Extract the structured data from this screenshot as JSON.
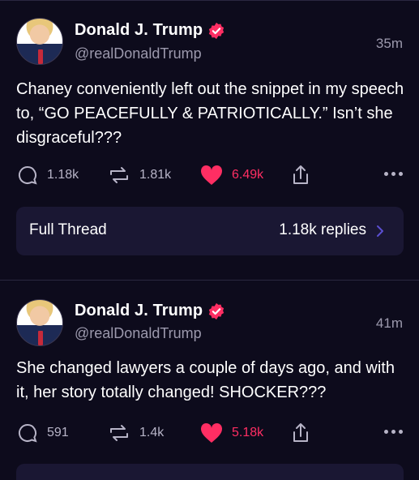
{
  "posts": [
    {
      "author": "Donald J. Trump",
      "handle": "@realDonaldTrump",
      "time": "35m",
      "text": "Chaney conveniently left out the snippet in my speech to, “GO PEACEFULLY & PATRIOTICALLY.” Isn’t she disgraceful???",
      "replies": "1.18k",
      "reposts": "1.81k",
      "likes": "6.49k"
    },
    {
      "author": "Donald J. Trump",
      "handle": "@realDonaldTrump",
      "time": "41m",
      "text": "She changed lawyers a couple of days ago, and with it, her story totally changed! SHOCKER???",
      "replies": "591",
      "reposts": "1.4k",
      "likes": "5.18k"
    }
  ],
  "thread": {
    "label": "Full Thread",
    "replies": "1.18k replies"
  },
  "colors": {
    "background": "#0d0b1c",
    "like": "#ff2e63",
    "verified": "#ff2e63",
    "card": "#1a1733",
    "muted": "#9c99ad"
  },
  "icons": [
    "reply-icon",
    "repost-icon",
    "heart-icon",
    "share-icon",
    "more-icon",
    "verified-icon",
    "chevron-right-icon"
  ]
}
